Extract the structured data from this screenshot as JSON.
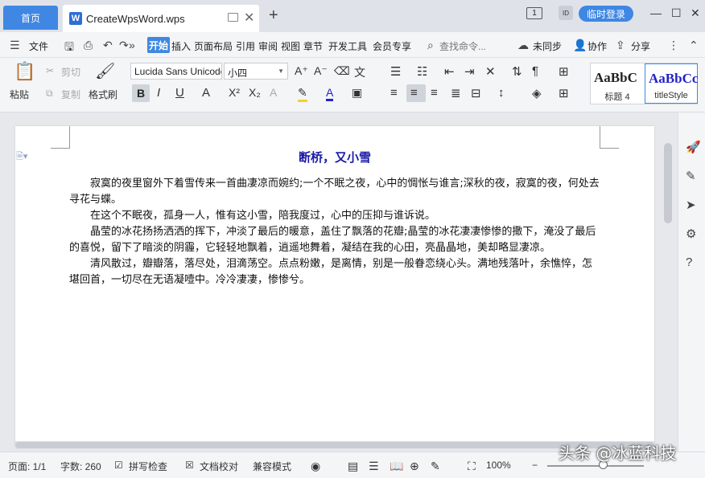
{
  "tabs": {
    "home_label": "首页",
    "doc_label": "CreateWpsWord.wps",
    "add_label": "+"
  },
  "titlebar": {
    "badge": "1",
    "avatar_text": "ID",
    "login_label": "临时登录"
  },
  "menu": {
    "file_label": "文件",
    "more_label": "»",
    "items": [
      "开始",
      "插入",
      "页面布局",
      "引用",
      "审阅",
      "视图",
      "章节",
      "开发工具",
      "会员专享"
    ],
    "search_placeholder": "查找命令...",
    "sync_label": "未同步",
    "collab_label": "协作",
    "share_label": "分享",
    "more_menu": "⋮"
  },
  "ribbon": {
    "paste_label": "粘贴",
    "cut_label": "剪切",
    "copy_label": "复制",
    "format_painter_label": "格式刷",
    "font_name": "Lucida Sans Unicode",
    "font_size": "小四",
    "style1_sample": "AaBbC",
    "style1_name": "标题 4",
    "style2_sample": "AaBbCc",
    "style2_name": "titleStyle"
  },
  "document": {
    "title": "断桥，又小雪",
    "paragraphs": [
      "寂寞的夜里窗外下着雪传来一首曲凄凉而婉约;一个不眠之夜，心中的惆怅与谁言;深秋的夜，寂寞的夜，何处去寻花与蝶。",
      "在这个不眠夜，孤身一人，惟有这小雪，陪我度过，心中的压抑与谁诉说。",
      "晶莹的冰花扬扬洒洒的挥下，冲淡了最后的暖意，盖住了飘落的花瓣;晶莹的冰花凄凄惨惨的撒下，淹没了最后的喜悦，留下了暗淡的阴霾，它轻轻地飘着，逍遥地舞着，凝结在我的心田，亮晶晶地，美却略显凄凉。",
      "清风散过，瓣瓣落，落尽处，泪滴荡空。点点粉嫩，是离情，别是一般眷恋绕心头。满地残落叶，余憔悴，怎堪回首，一切尽在无语凝噎中。冷冷凄凄，惨惨兮。"
    ]
  },
  "statusbar": {
    "page_info": "页面: 1/1",
    "word_count": "字数: 260",
    "spellcheck_label": "拼写检查",
    "proofread_label": "文档校对",
    "compat_label": "兼容模式",
    "zoom_level": "100%",
    "zoom_fraction": 0.55
  },
  "watermark": "头条 @冰蓝科技",
  "colors": {
    "accent": "#3f87e3",
    "title_color": "#1a1aa8"
  }
}
